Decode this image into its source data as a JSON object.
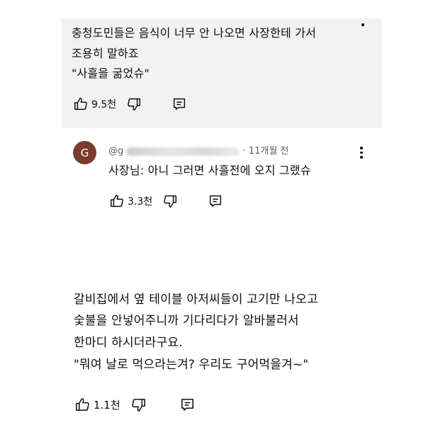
{
  "comment1": {
    "lines": [
      "충청도민들은 음식이 너무 안 나오면 사장한테 가서",
      "조용히 말하죠",
      "\"사흘을 굶었슈\""
    ],
    "like_count": "9.5천"
  },
  "reply": {
    "avatar_letter": "G",
    "author_fragment": "@g",
    "time": "· 11개월 전",
    "text": "사장님: 아니 그러면 사흘전에 오지 그랬슈",
    "like_count": "3.3천"
  },
  "comment2": {
    "lines": [
      "갈비집에서 옆 테이블 아저씨들이 고기만 나오고",
      "숯불을 안넣어주니까 기다리다가 알바불러서",
      "한마디 하시더라구요.",
      "\"뭐여 날로 먹으라는겨? 우리도 구어먹을겨~\""
    ],
    "like_count": "1.1천"
  },
  "icons": {
    "like": "thumbs-up-icon",
    "dislike": "thumbs-down-icon",
    "reply": "reply-icon",
    "more": "more-vert-icon"
  }
}
